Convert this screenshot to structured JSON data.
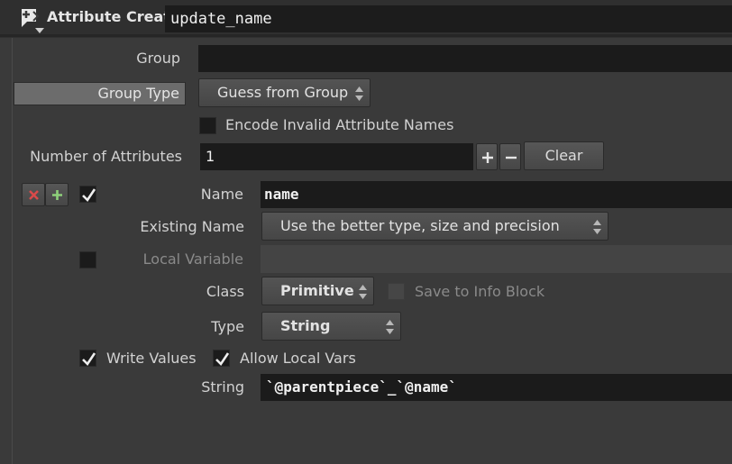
{
  "header": {
    "node_type": "Attribute Create",
    "node_name": "update_name"
  },
  "group": {
    "label": "Group",
    "value": ""
  },
  "group_type": {
    "label": "Group Type",
    "value": "Guess from Group"
  },
  "encode_invalid": {
    "label": "Encode Invalid Attribute Names",
    "checked": false
  },
  "num_attributes": {
    "label": "Number of Attributes",
    "value": "1",
    "clear_label": "Clear"
  },
  "attribute": {
    "enabled": true,
    "name_label": "Name",
    "name_value": "name",
    "existing_label": "Existing Name",
    "existing_value": "Use the better type, size and precision",
    "local_var_label": "Local Variable",
    "local_var_checked": false,
    "local_var_value": "",
    "class_label": "Class",
    "class_value": "Primitive",
    "save_info_label": "Save to Info Block",
    "save_info_checked": false,
    "type_label": "Type",
    "type_value": "String",
    "write_values_label": "Write Values",
    "write_values_checked": true,
    "allow_local_label": "Allow Local Vars",
    "allow_local_checked": true,
    "string_label": "String",
    "string_value": "`@parentpiece`_`@name`"
  },
  "colors": {
    "background": "#3a3a3a",
    "field": "#1b1b1b",
    "group_type_bar": "#6c6c6c",
    "remove_icon": "#d94a4a",
    "add_icon": "#8ed07a"
  },
  "icons": [
    "node-tool-icon",
    "menu-arrow-icon",
    "updown-arrows-icon",
    "plus-icon",
    "minus-icon",
    "remove-icon",
    "add-icon",
    "checkmark-icon"
  ]
}
